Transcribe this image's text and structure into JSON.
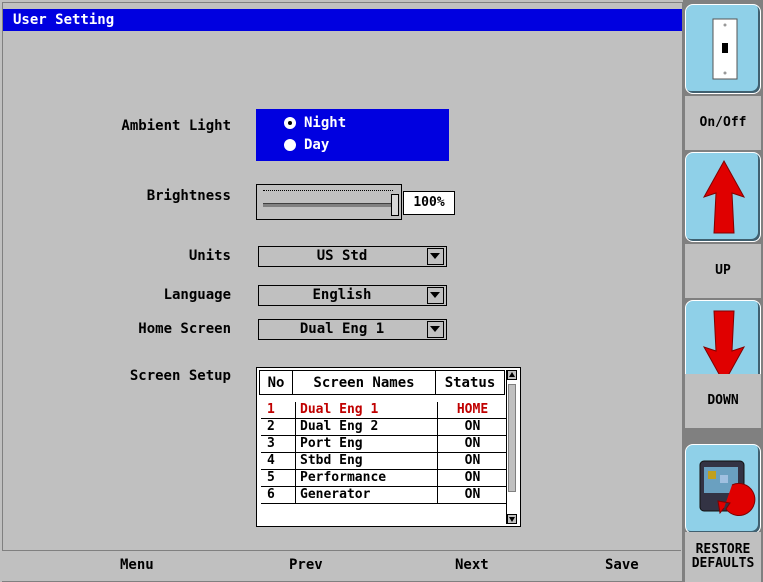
{
  "window": {
    "title": "User Setting"
  },
  "settings": {
    "ambient_light": {
      "label": "Ambient Light",
      "options": [
        {
          "label": "Night",
          "selected": true
        },
        {
          "label": "Day",
          "selected": false
        }
      ]
    },
    "brightness": {
      "label": "Brightness",
      "value_percent": 100,
      "value_text": "100%"
    },
    "units": {
      "label": "Units",
      "value": "US Std"
    },
    "language": {
      "label": "Language",
      "value": "English"
    },
    "home_screen": {
      "label": "Home Screen",
      "value": "Dual Eng 1"
    },
    "screen_setup": {
      "label": "Screen Setup",
      "columns": [
        "No",
        "Screen Names",
        "Status"
      ],
      "rows": [
        {
          "no": "1",
          "name": "Dual Eng 1",
          "status": "HOME"
        },
        {
          "no": "2",
          "name": "Dual Eng 2",
          "status": "ON"
        },
        {
          "no": "3",
          "name": "Port Eng",
          "status": "ON"
        },
        {
          "no": "4",
          "name": "Stbd Eng",
          "status": "ON"
        },
        {
          "no": "5",
          "name": "Performance",
          "status": "ON"
        },
        {
          "no": "6",
          "name": "Generator",
          "status": "ON"
        }
      ]
    }
  },
  "bottom_bar": {
    "menu": "Menu",
    "prev": "Prev",
    "next": "Next",
    "save": "Save"
  },
  "sidebar": {
    "on_off": {
      "label": "On/Off",
      "icon": "light-switch-icon"
    },
    "up": {
      "label": "UP",
      "icon": "up-arrow-icon"
    },
    "down": {
      "label": "DOWN",
      "icon": "down-arrow-icon"
    },
    "restore": {
      "label_line1": "RESTORE",
      "label_line2": "DEFAULTS",
      "icon": "restore-defaults-icon"
    }
  },
  "colors": {
    "title_bar": "#0000e0",
    "panel": "#c0c0c0",
    "side_button": "#8fd0e8",
    "arrow": "#e00000",
    "home_row": "#c00000"
  }
}
